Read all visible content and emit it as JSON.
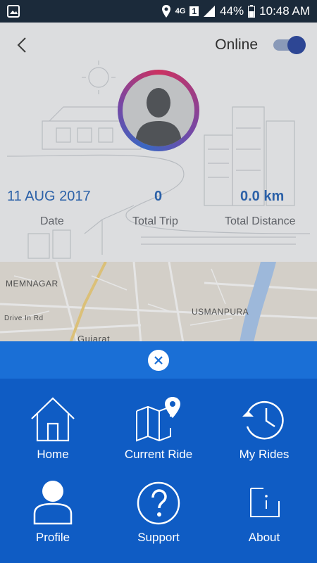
{
  "status_bar": {
    "network": "4G",
    "sim": "1",
    "battery": "44%",
    "time": "10:48 AM"
  },
  "header": {
    "online_label": "Online",
    "online_toggle": true
  },
  "stats": {
    "date_value": "11 AUG 2017",
    "date_label": "Date",
    "trip_value": "0",
    "trip_label": "Total Trip",
    "distance_value": "0.0 km",
    "distance_label": "Total Distance"
  },
  "map": {
    "labels": [
      "MEMNAGAR",
      "USMANPURA",
      "Drive In Rd",
      "Gujarat"
    ]
  },
  "menu": {
    "items": [
      {
        "label": "Home",
        "icon": "home-icon"
      },
      {
        "label": "Current Ride",
        "icon": "map-pin-icon"
      },
      {
        "label": "My Rides",
        "icon": "history-icon"
      },
      {
        "label": "Profile",
        "icon": "profile-icon"
      },
      {
        "label": "Support",
        "icon": "help-icon"
      },
      {
        "label": "About",
        "icon": "info-icon"
      }
    ]
  },
  "colors": {
    "sheet": "#0f5cc4",
    "sheet_header": "#1a6fd6",
    "accent_text": "#1e5fb5",
    "toggle_knob": "#1f3e9d"
  }
}
